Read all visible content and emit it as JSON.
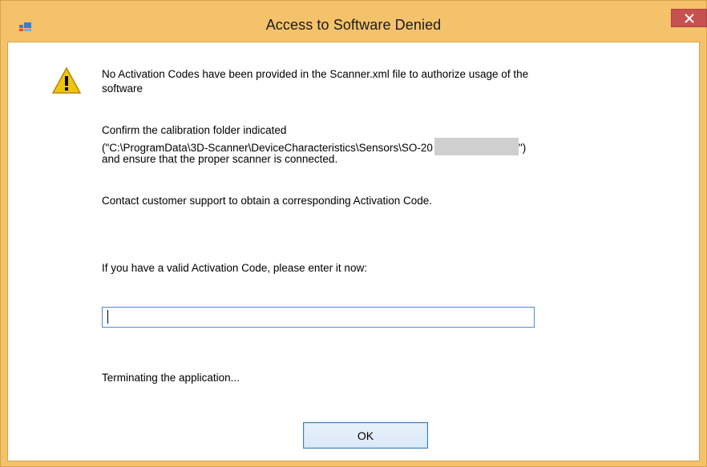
{
  "window": {
    "title": "Access to Software Denied"
  },
  "message": {
    "line1": "No Activation Codes have been provided in the Scanner.xml file to authorize usage of the",
    "line2": "software",
    "confirm_line1": "Confirm the calibration folder indicated",
    "confirm_path": "(\"C:\\ProgramData\\3D-Scanner\\DeviceCharacteristics\\Sensors\\SO-20",
    "confirm_path_end": "\")",
    "confirm_line3": "and ensure that the proper scanner is connected.",
    "contact": "Contact customer support to obtain a corresponding Activation Code.",
    "prompt": "If you have a valid Activation Code, please enter it now:",
    "terminating": "Terminating the application..."
  },
  "activation_input": {
    "value": "",
    "placeholder": ""
  },
  "buttons": {
    "ok_label": "OK"
  },
  "colors": {
    "title_bar": "#f4c26b",
    "close_button": "#c75050",
    "input_border": "#4f8bd6",
    "ok_border": "#3c7fb1"
  },
  "icons": {
    "app": "window-app-icon",
    "close": "close-icon",
    "warning": "warning-triangle-icon"
  }
}
